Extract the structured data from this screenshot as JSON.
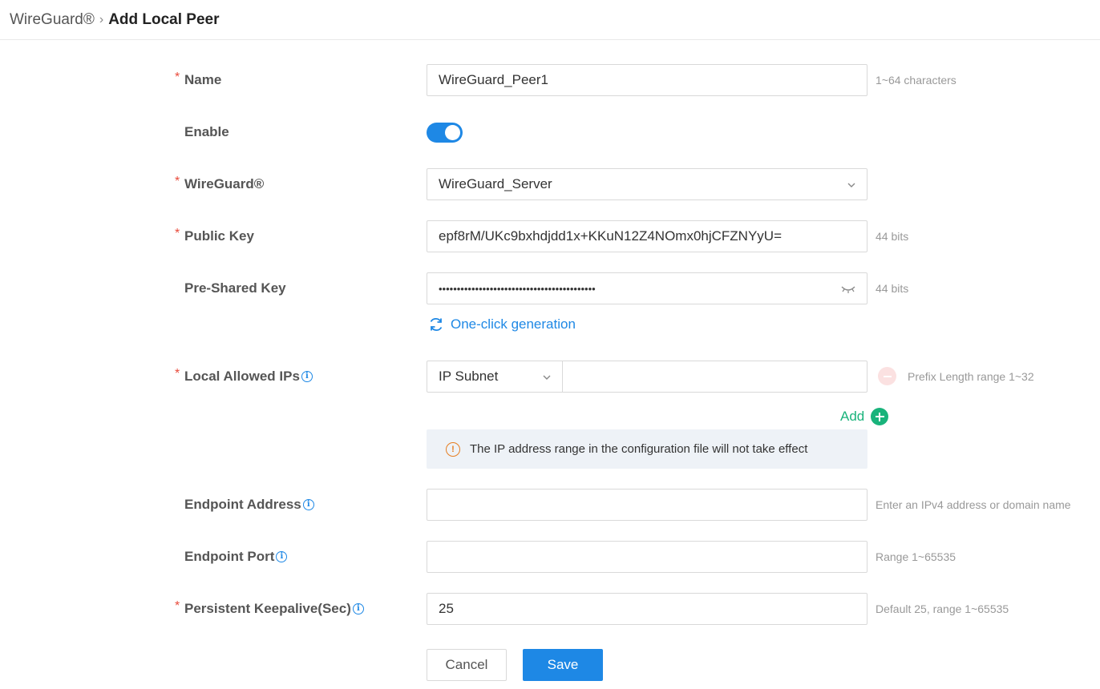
{
  "breadcrumb": {
    "parent": "WireGuard®",
    "separator": "›",
    "current": "Add Local Peer"
  },
  "form": {
    "name": {
      "label": "Name",
      "required": "*",
      "value": "WireGuard_Peer1",
      "hint": "1~64 characters"
    },
    "enable": {
      "label": "Enable",
      "state": "on"
    },
    "wireguard": {
      "label": "WireGuard®",
      "required": "*",
      "value": "WireGuard_Server"
    },
    "public_key": {
      "label": "Public Key",
      "required": "*",
      "value": "epf8rM/UKc9bxhdjdd1x+KKuN12Z4NOmx0hjCFZNYyU=",
      "hint": "44 bits"
    },
    "pre_shared_key": {
      "label": "Pre-Shared Key",
      "value": "•••••••••••••••••••••••••••••••••••••••••••",
      "hint": "44 bits",
      "generate_label": "One-click generation"
    },
    "local_allowed_ips": {
      "label": "Local Allowed IPs",
      "required": "*",
      "type": "IP Subnet",
      "value": "",
      "hint": "Prefix Length range 1~32",
      "add_label": "Add",
      "notice": "The IP address range in the configuration file will not take effect"
    },
    "endpoint_address": {
      "label": "Endpoint Address",
      "value": "",
      "hint": "Enter an IPv4 address or domain name"
    },
    "endpoint_port": {
      "label": "Endpoint Port",
      "value": "",
      "hint": "Range 1~65535"
    },
    "keepalive": {
      "label": "Persistent Keepalive(Sec)",
      "required": "*",
      "value": "25",
      "hint": "Default 25, range 1~65535"
    }
  },
  "buttons": {
    "cancel": "Cancel",
    "save": "Save"
  },
  "colors": {
    "accent": "#1e88e5",
    "required": "#e94b3c",
    "add": "#19b37b",
    "warning": "#e67e22"
  }
}
